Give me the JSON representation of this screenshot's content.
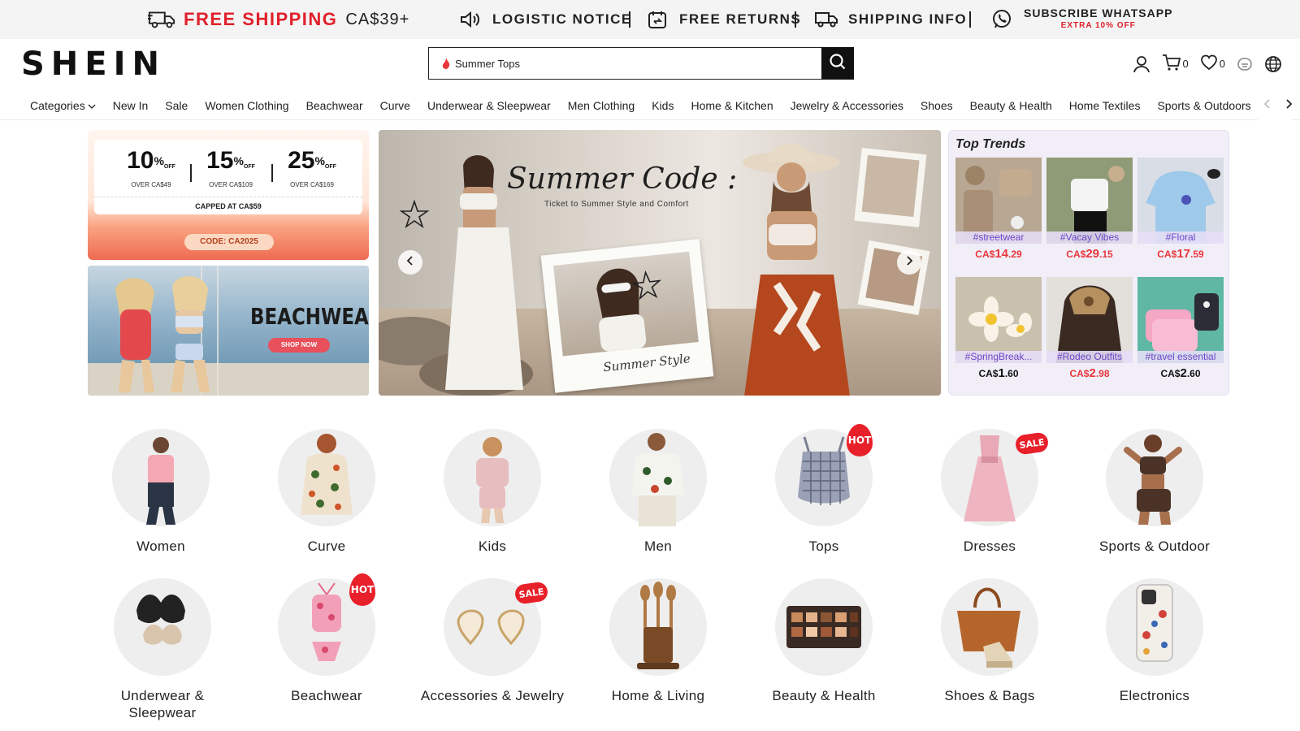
{
  "topbar": {
    "free_shipping": "FREE SHIPPING",
    "free_shipping_price": "CA$39+",
    "logistic": "LOGISTIC NOTICE",
    "returns": "FREE RETURNS",
    "shipping_info": "SHIPPING INFO",
    "whatsapp": "SUBSCRIBE WHATSAPP",
    "whatsapp_offer": "EXTRA 10% OFF"
  },
  "header": {
    "logo": "SHEIN",
    "search_value": "Summer Tops",
    "cart_count": "0",
    "wishlist_count": "0"
  },
  "nav": {
    "items": [
      "Categories",
      "New In",
      "Sale",
      "Women Clothing",
      "Beachwear",
      "Curve",
      "Underwear & Sleepwear",
      "Men Clothing",
      "Kids",
      "Home & Kitchen",
      "Jewelry & Accessories",
      "Shoes",
      "Beauty & Health",
      "Home Textiles",
      "Sports & Outdoors"
    ]
  },
  "promo": {
    "tiers": [
      {
        "pct": "10",
        "over": "OVER CA$49"
      },
      {
        "pct": "15",
        "over": "OVER CA$109"
      },
      {
        "pct": "25",
        "over": "OVER CA$169"
      }
    ],
    "pct_symbol": "%",
    "off": "OFF",
    "capped": "CAPPED AT CA$59",
    "code": "CODE: CA2025"
  },
  "beach": {
    "title": "BEACHWEAR",
    "button": "SHOP NOW"
  },
  "hero": {
    "title": "Summer Code :",
    "subtitle": "Ticket to Summer Style and Comfort",
    "caption": "Summer Style"
  },
  "trends": {
    "title": "Top Trends",
    "items": [
      {
        "tag": "#streetwear",
        "currency": "CA$",
        "whole": "14",
        "cents": ".29",
        "color": "red"
      },
      {
        "tag": "#Vacay Vibes",
        "currency": "CA$",
        "whole": "29",
        "cents": ".15",
        "color": "red"
      },
      {
        "tag": "#Floral",
        "currency": "CA$",
        "whole": "17",
        "cents": ".59",
        "color": "red"
      },
      {
        "tag": "#SpringBreak...",
        "currency": "CA$",
        "whole": "1",
        "cents": ".60",
        "color": "black"
      },
      {
        "tag": "#Rodeo Outfits",
        "currency": "CA$",
        "whole": "2",
        "cents": ".98",
        "color": "red"
      },
      {
        "tag": "#travel essential",
        "currency": "CA$",
        "whole": "2",
        "cents": ".60",
        "color": "black"
      }
    ]
  },
  "categories": {
    "row1": [
      {
        "label": "Women",
        "badge": ""
      },
      {
        "label": "Curve",
        "badge": ""
      },
      {
        "label": "Kids",
        "badge": ""
      },
      {
        "label": "Men",
        "badge": ""
      },
      {
        "label": "Tops",
        "badge": "HOT"
      },
      {
        "label": "Dresses",
        "badge": "SALE"
      },
      {
        "label": "Sports & Outdoor",
        "badge": ""
      }
    ],
    "row2": [
      {
        "label": "Underwear & Sleepwear",
        "badge": ""
      },
      {
        "label": "Beachwear",
        "badge": "HOT"
      },
      {
        "label": "Accessories & Jewelry",
        "badge": "SALE"
      },
      {
        "label": "Home & Living",
        "badge": ""
      },
      {
        "label": "Beauty & Health",
        "badge": ""
      },
      {
        "label": "Shoes & Bags",
        "badge": ""
      },
      {
        "label": "Electronics",
        "badge": ""
      }
    ]
  },
  "colors": {
    "accent_red": "#e0202a",
    "trend_purple": "#6b45c8"
  }
}
